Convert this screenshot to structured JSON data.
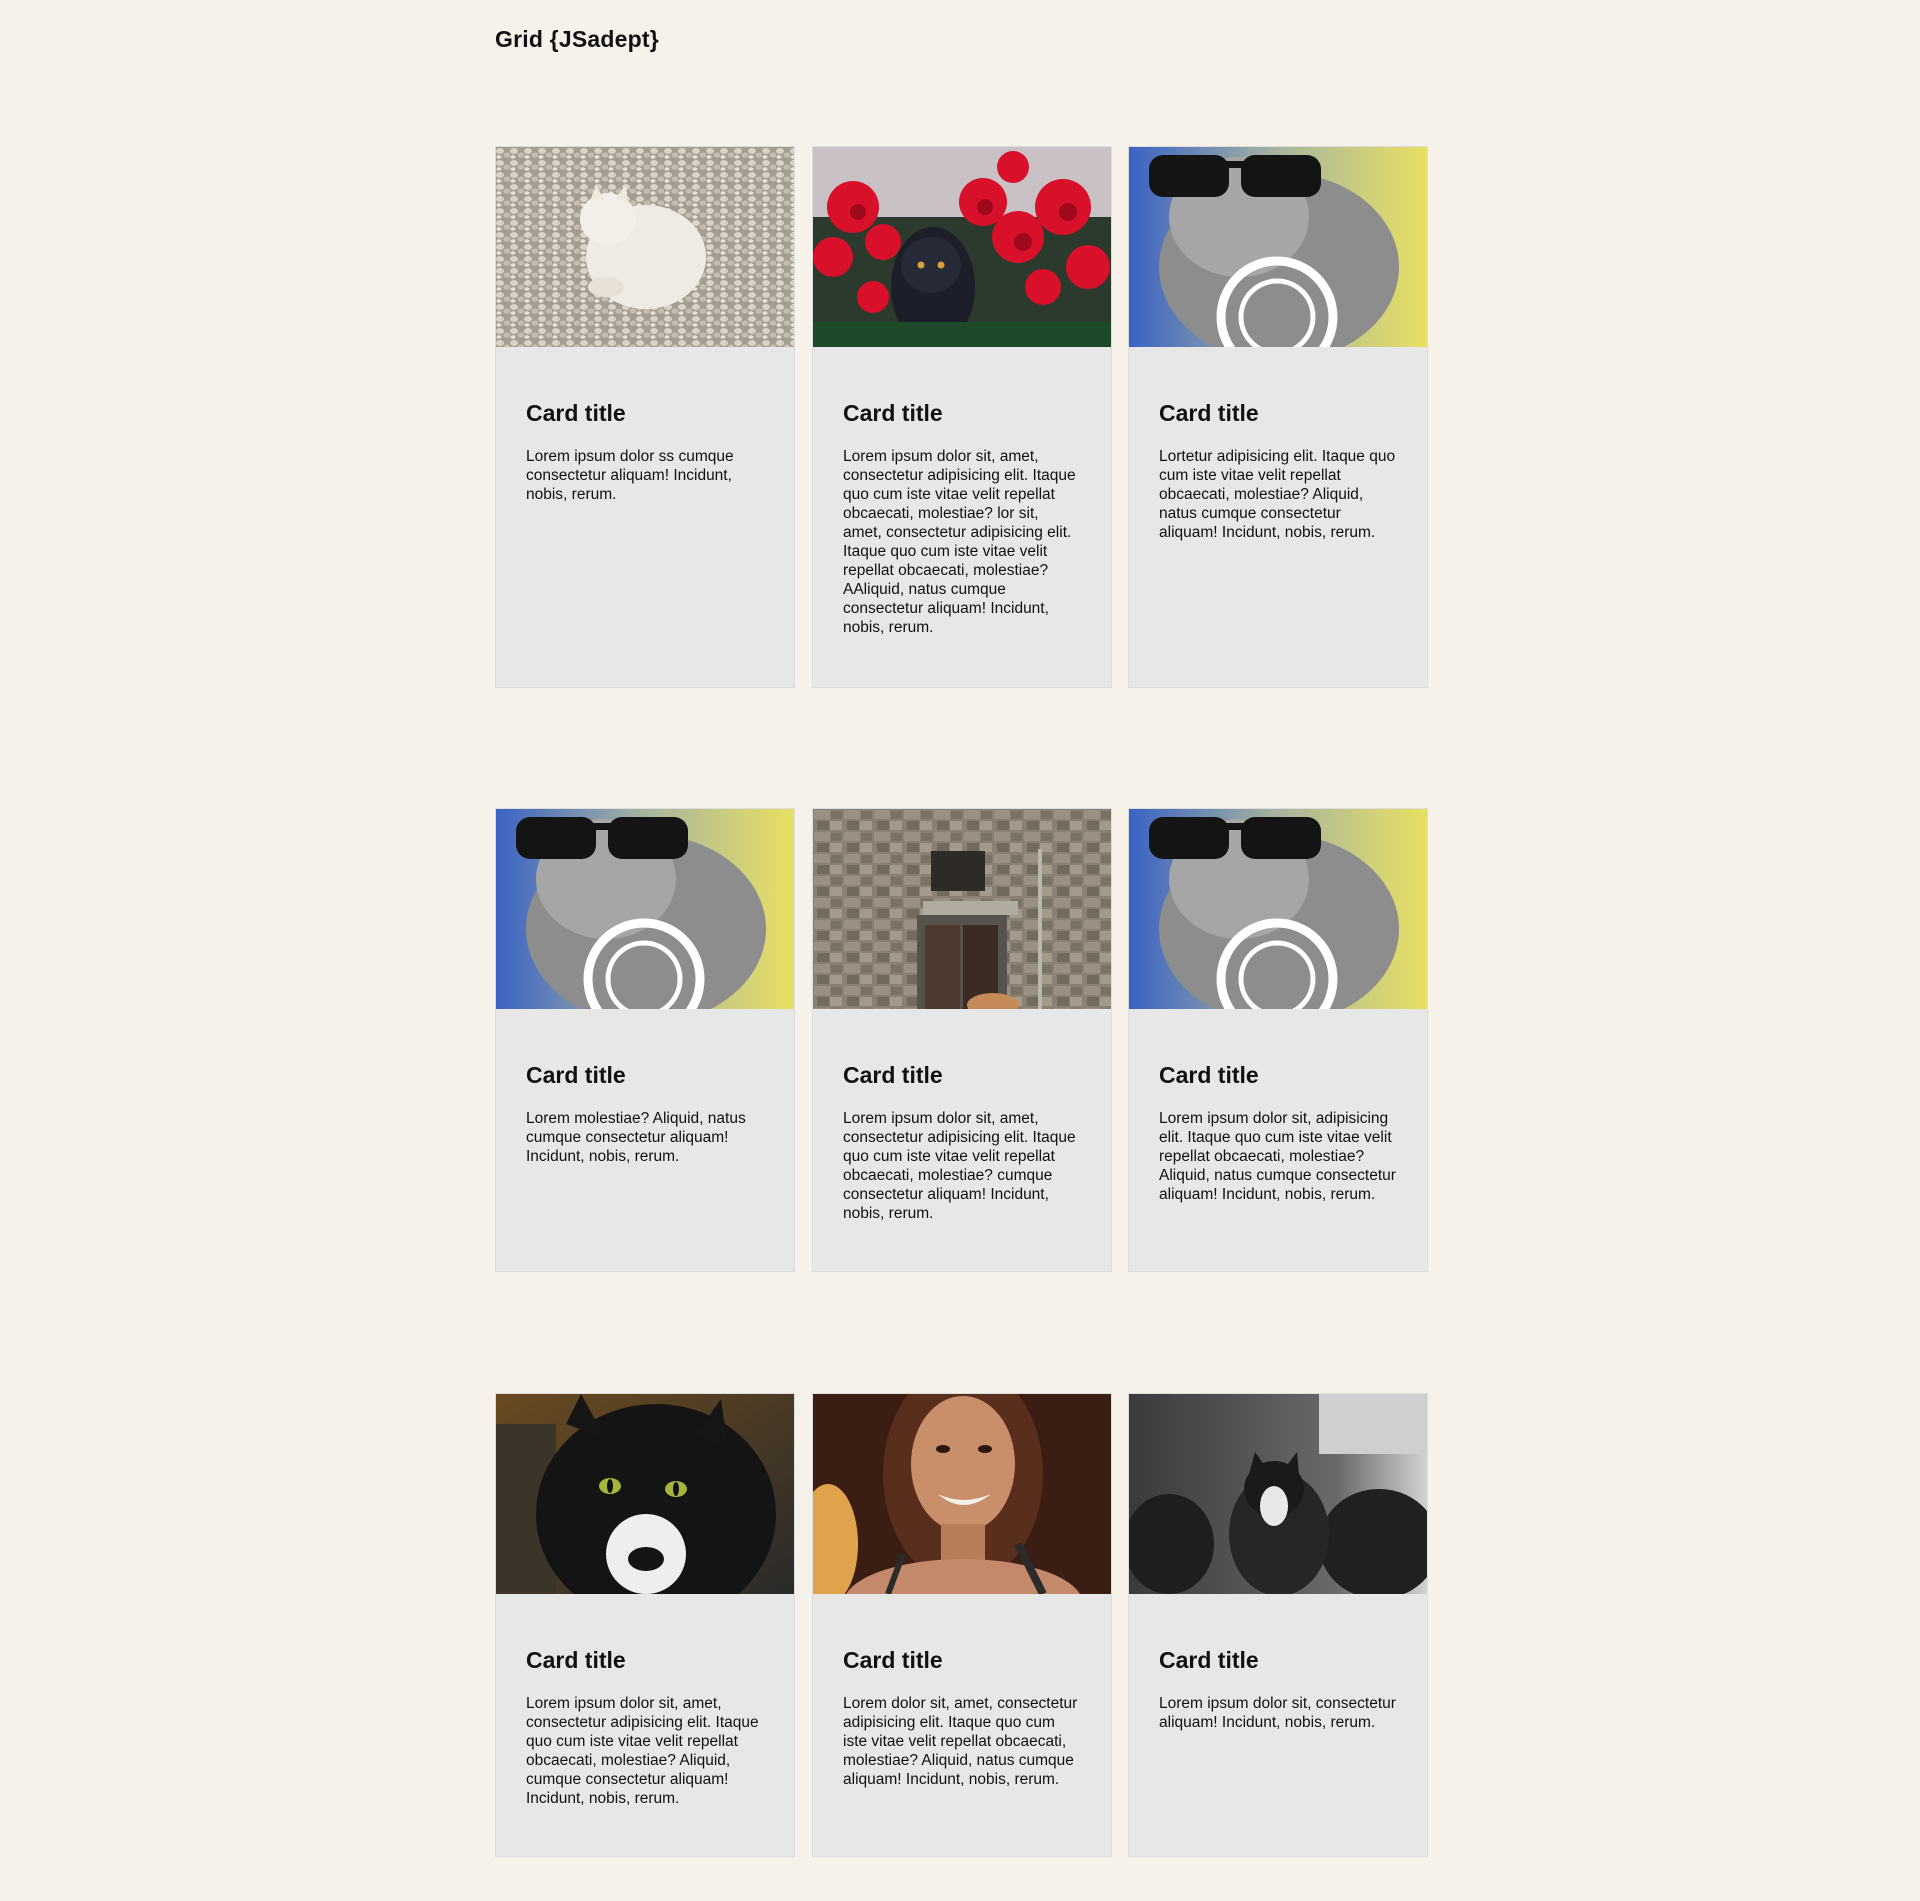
{
  "page": {
    "title": "Grid {JSadept}"
  },
  "cards": [
    {
      "title": "Card title",
      "text": "Lorem ipsum dolor ss cumque consectetur aliquam! Incidunt, nobis, rerum.",
      "image": "white-cat-on-pebbles",
      "image_colors": [
        "#b9b3a8",
        "#f0ece4"
      ]
    },
    {
      "title": "Card title",
      "text": "Lorem ipsum dolor sit, amet, consectetur adipisicing elit. Itaque quo cum iste vitae velit repellat obcaecati, molestiae? lor sit, amet, consectetur adipisicing elit. Itaque quo cum iste vitae velit repellat obcaecati, molestiae? AAliquid, natus cumque consectetur aliquam! Incidunt, nobis, rerum.",
      "image": "black-cat-red-flowers",
      "image_colors": [
        "#d8102a",
        "#1c1f2a"
      ]
    },
    {
      "title": "Card title",
      "text": "Lortetur adipisicing elit. Itaque quo cum iste vitae velit repellat obcaecati, molestiae? Aliquid, natus cumque consectetur aliquam! Incidunt, nobis, rerum.",
      "image": "cat-with-sunglasses",
      "image_colors": [
        "#3a63c4",
        "#e8e062"
      ]
    },
    {
      "title": "Card title",
      "text": "Lorem molestiae? Aliquid, natus cumque consectetur aliquam! Incidunt, nobis, rerum.",
      "image": "cat-with-sunglasses",
      "image_colors": [
        "#3a63c4",
        "#e8e062"
      ]
    },
    {
      "title": "Card title",
      "text": "Lorem ipsum dolor sit, amet, consectetur adipisicing elit. Itaque quo cum iste vitae velit repellat obcaecati, molestiae? cumque consectetur aliquam! Incidunt, nobis, rerum.",
      "image": "stone-wall-doorway",
      "image_colors": [
        "#8a8174",
        "#4d3a30"
      ]
    },
    {
      "title": "Card title",
      "text": "Lorem ipsum dolor sit, adipisicing elit. Itaque quo cum iste vitae velit repellat obcaecati, molestiae? Aliquid, natus cumque consectetur aliquam! Incidunt, nobis, rerum.",
      "image": "cat-with-sunglasses",
      "image_colors": [
        "#3a63c4",
        "#e8e062"
      ]
    },
    {
      "title": "Card title",
      "text": "Lorem ipsum dolor sit, amet, consectetur adipisicing elit. Itaque quo cum iste vitae velit repellat obcaecati, molestiae? Aliquid, cumque consectetur aliquam! Incidunt, nobis, rerum.",
      "image": "black-white-cat",
      "image_colors": [
        "#6a4a20",
        "#141414"
      ]
    },
    {
      "title": "Card title",
      "text": "Lorem dolor sit, amet, consectetur adipisicing elit. Itaque quo cum iste vitae velit repellat obcaecati, molestiae? Aliquid, natus cumque aliquam! Incidunt, nobis, rerum.",
      "image": "smiling-woman",
      "image_colors": [
        "#3a1e14",
        "#c98e6a"
      ]
    },
    {
      "title": "Card title",
      "text": "Lorem ipsum dolor sit, consectetur aliquam! Incidunt, nobis, rerum.",
      "image": "kittens-grayscale",
      "image_colors": [
        "#2a2a2a",
        "#9a9a9a"
      ]
    }
  ]
}
